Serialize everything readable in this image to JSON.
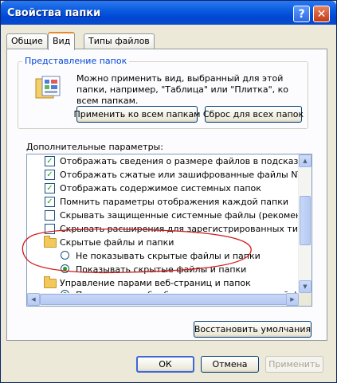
{
  "window": {
    "title": "Свойства папки",
    "help": "?",
    "close": "✕"
  },
  "tabs": [
    "Общие",
    "Вид",
    "Типы файлов"
  ],
  "folder_views": {
    "title": "Представление папок",
    "description": "Можно применить вид, выбранный для этой папки, например, \"Таблица\" или \"Плитка\", ко всем папкам.",
    "apply_all": "Применить ко всем папкам",
    "reset_all": "Сброс для всех папок"
  },
  "advanced": {
    "label": "Дополнительные параметры:",
    "items": [
      {
        "type": "checkbox",
        "checked": true,
        "text": "Отображать сведения о размере файлов в подсказках папок"
      },
      {
        "type": "checkbox",
        "checked": true,
        "text": "Отображать сжатые или зашифрованные файлы NTFS другим цветом"
      },
      {
        "type": "checkbox",
        "checked": true,
        "text": "Отображать содержимое системных папок"
      },
      {
        "type": "checkbox",
        "checked": true,
        "text": "Помнить параметры отображения каждой папки"
      },
      {
        "type": "checkbox",
        "checked": false,
        "text": "Скрывать защищенные системные файлы (рекомендуется)"
      },
      {
        "type": "checkbox",
        "checked": false,
        "text": "Скрывать расширения для зарегистрированных типов файлов"
      },
      {
        "type": "folder",
        "text": "Скрытые файлы и папки"
      },
      {
        "type": "radio",
        "checked": false,
        "text": "Не показывать скрытые файлы и папки"
      },
      {
        "type": "radio",
        "checked": true,
        "text": "Показывать скрытые файлы и папки"
      },
      {
        "type": "folder",
        "text": "Управление парами веб-страниц и папок"
      },
      {
        "type": "radio",
        "checked": true,
        "text": "Показывать и обрабатывать пару как единый файл"
      }
    ]
  },
  "buttons": {
    "restore_defaults": "Восстановить умолчания",
    "ok": "ОК",
    "cancel": "Отмена",
    "apply": "Применить"
  },
  "colors": {
    "title_bar": "#0a5ce0",
    "annotation": "#d11a1a",
    "check": "#21a121"
  }
}
